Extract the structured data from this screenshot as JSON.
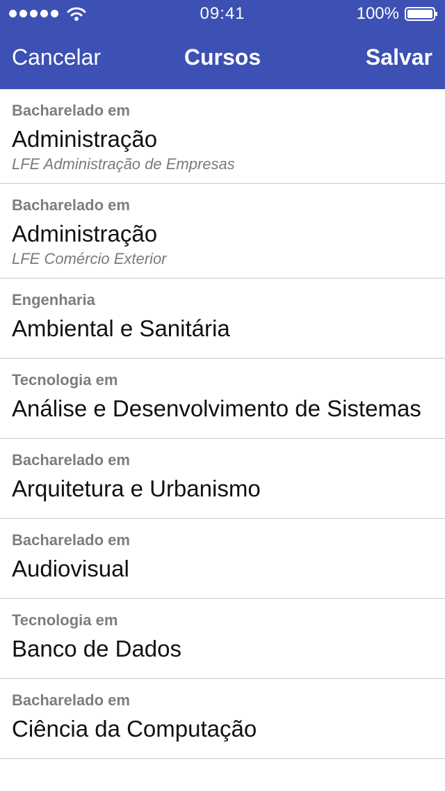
{
  "status_bar": {
    "time": "09:41",
    "battery_percent": "100%",
    "signal_bars": 5,
    "battery_level": 1.0
  },
  "nav": {
    "cancel_label": "Cancelar",
    "title": "Cursos",
    "save_label": "Salvar"
  },
  "colors": {
    "accent": "#3d50b3",
    "separator": "#c8c7cc",
    "category_text": "#7d7d7d"
  },
  "courses": [
    {
      "category": "Bacharelado em",
      "name": "Administração",
      "detail": "LFE Administração de Empresas"
    },
    {
      "category": "Bacharelado em",
      "name": "Administração",
      "detail": "LFE Comércio Exterior"
    },
    {
      "category": "Engenharia",
      "name": "Ambiental e Sanitária",
      "detail": ""
    },
    {
      "category": "Tecnologia em",
      "name": "Análise e Desenvolvimento de Sistemas",
      "detail": ""
    },
    {
      "category": "Bacharelado em",
      "name": "Arquitetura e Urbanismo",
      "detail": ""
    },
    {
      "category": "Bacharelado em",
      "name": "Audiovisual",
      "detail": ""
    },
    {
      "category": "Tecnologia em",
      "name": "Banco de Dados",
      "detail": ""
    },
    {
      "category": "Bacharelado em",
      "name": "Ciência da Computação",
      "detail": ""
    }
  ]
}
